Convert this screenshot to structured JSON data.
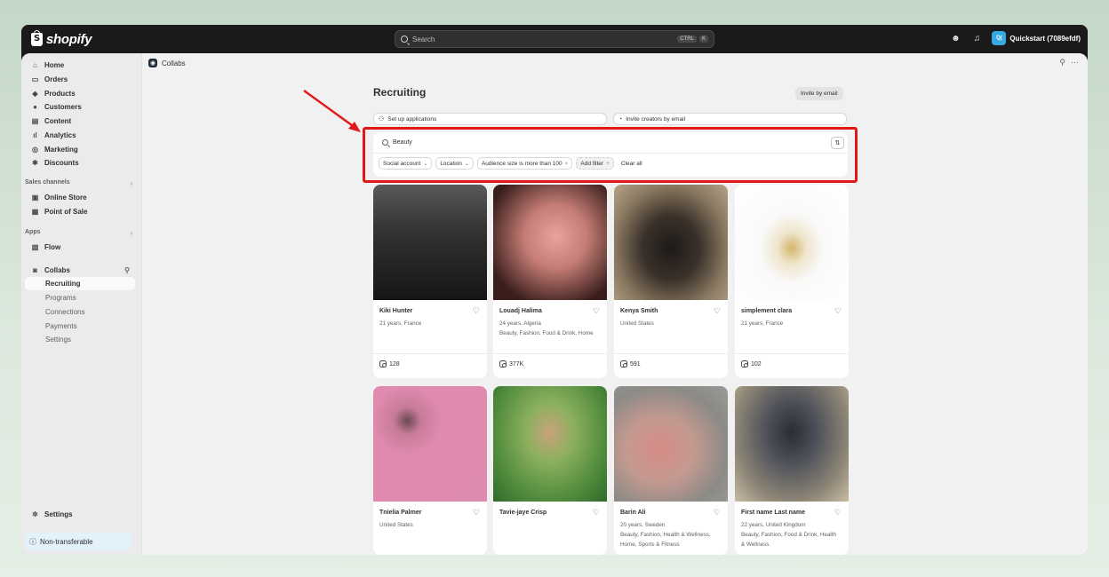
{
  "topbar": {
    "logo_text": "shopify",
    "search_placeholder": "Search",
    "shortcut_key1": "CTRL",
    "shortcut_key2": "K",
    "store_initials": "Q(",
    "store_name": "Quickstart (7089efdf)"
  },
  "sidebar": {
    "items": [
      {
        "label": "Home",
        "icon": "home-icon"
      },
      {
        "label": "Orders",
        "icon": "inbox-icon"
      },
      {
        "label": "Products",
        "icon": "tag-icon"
      },
      {
        "label": "Customers",
        "icon": "person-icon"
      },
      {
        "label": "Content",
        "icon": "content-icon"
      },
      {
        "label": "Analytics",
        "icon": "bar-chart-icon"
      },
      {
        "label": "Marketing",
        "icon": "target-icon"
      },
      {
        "label": "Discounts",
        "icon": "discount-icon"
      }
    ],
    "sales_channels_label": "Sales channels",
    "sales_channels": [
      {
        "label": "Online Store",
        "icon": "store-icon"
      },
      {
        "label": "Point of Sale",
        "icon": "pos-icon"
      }
    ],
    "apps_label": "Apps",
    "apps": [
      {
        "label": "Flow",
        "icon": "flow-icon"
      },
      {
        "label": "Collabs",
        "icon": "collabs-icon"
      }
    ],
    "collabs_sub": [
      "Recruiting",
      "Programs",
      "Connections",
      "Payments",
      "Settings"
    ],
    "settings_label": "Settings",
    "nontransferable_label": "Non-transferable"
  },
  "content": {
    "breadcrumb": "Collabs",
    "page_title": "Recruiting",
    "invite_email_label": "Invite by email",
    "setup_applications_label": "Set up applications",
    "invite_creators_label": "Invite creators by email",
    "search_value": "Beauty",
    "filters": [
      {
        "label": "Social account",
        "type": "dropdown"
      },
      {
        "label": "Location",
        "type": "dropdown"
      },
      {
        "label": "Audience size is more than 100",
        "type": "applied"
      },
      {
        "label": "Add filter",
        "type": "add"
      },
      {
        "label": "Clear all",
        "type": "clear"
      }
    ]
  },
  "creators": [
    {
      "name": "Kiki Hunter",
      "info": "21 years, France",
      "stat": "128",
      "photo": "linear-gradient(180deg,#5a5a5a 0%,#333 40%,#151515 100%)"
    },
    {
      "name": "Louadj Halima",
      "info": "24 years, Algeria\nBeauty, Fashion, Food & Drink, Home",
      "stat": "377K",
      "photo": "radial-gradient(ellipse at 55% 45%,#e8a49c 0%,#c57d76 35%,#3a1e1c 80%)"
    },
    {
      "name": "Kenya Smith",
      "info": "United States",
      "stat": "591",
      "photo": "radial-gradient(ellipse at 50% 55%,#1d1a18 0%,#3a3029 35%,#8a7a62 70%,#b7a488 100%)"
    },
    {
      "name": "simplement clara",
      "info": "21 years, France",
      "stat": "102",
      "photo": "radial-gradient(ellipse at 50% 55%,#d4b46a 0%,#efe5cd 18%,#fafafa 40%,#ffffff 100%)"
    },
    {
      "name": "Tnielia Palmer",
      "info": "United States",
      "stat": "",
      "photo": "radial-gradient(circle at 30% 30%,#6a4a52 0%,#c77b97 12%,#e08ab0 30%,#df8aaf 100%)"
    },
    {
      "name": "Tavie-jaye Crisp",
      "info": "",
      "stat": "",
      "photo": "radial-gradient(ellipse at 50% 40%,#c9a27c 0%,#8bb05e 30%,#4f8a3c 70%,#2f6a2c 100%)"
    },
    {
      "name": "Barin Ali",
      "info": "20 years, Sweden\nBeauty, Fashion, Health & Wellness, Home, Sports & Fitness",
      "stat": "",
      "photo": "radial-gradient(ellipse at 40% 55%,#d68b87 0%,#c49a90 35%,#8c8a86 70%,#9a9a98 100%)"
    },
    {
      "name": "First name Last name",
      "info": "22 years, United Kingdom\nBeauty, Fashion, Food & Drink, Health & Wellness",
      "stat": "",
      "photo": "radial-gradient(ellipse at 50% 40%,#2a2d36 0%,#4b4f58 30%,#8d8576 70%,#c9bca4 100%)"
    }
  ],
  "annotation": {
    "highlight_color": "#e11818"
  }
}
